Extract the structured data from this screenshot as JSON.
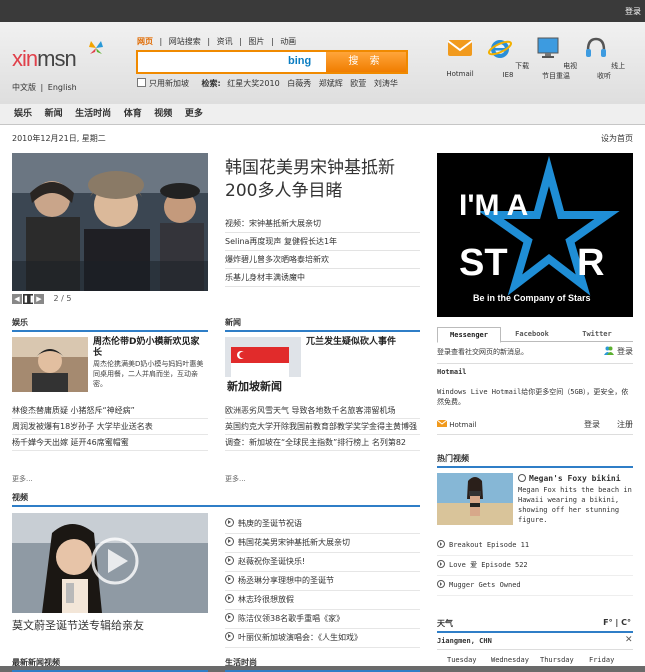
{
  "topbar": {
    "login": "登录"
  },
  "header": {
    "logo_prefix": "xin",
    "logo_suffix": "msn",
    "lang": [
      "中文版",
      "|",
      "English"
    ],
    "search_tabs": [
      "网页",
      "|",
      "网站搜索",
      "|",
      "资讯",
      "|",
      "图片",
      "|",
      "动画"
    ],
    "search_value": "",
    "bing_label": "bing",
    "search_button": "搜 索",
    "option_checkbox": "只用新加坡",
    "hot_label": "检索:",
    "hot_terms": [
      "红星大奖2010",
      "白薇秀",
      "郑斌辉",
      "欧萱",
      "刘涛华"
    ],
    "apps": [
      {
        "label": "Hotmail",
        "icon": "envelope-icon"
      },
      {
        "label": "下载IE8",
        "icon": "ie-icon"
      },
      {
        "label": "电视节目重温",
        "icon": "monitor-icon"
      },
      {
        "label": "线上收听",
        "icon": "headphones-icon"
      }
    ]
  },
  "nav": [
    "娱乐",
    "新闻",
    "生活时尚",
    "体育",
    "视频",
    "更多"
  ],
  "content": {
    "date": "2010年12月21日, 星期二",
    "set_home": "设为首页",
    "pager": {
      "prev": "◀",
      "pause": "❚❚",
      "next": "▶",
      "text": "2 / 5"
    },
    "headline": "韩国花美男宋钟基抵新200多人争目睹",
    "headline_links": [
      "视频：宋钟基抵新大展亲切",
      "Selina再度现声 复健假长达1年",
      "爆炸碧儿曾多次晒咯泰培新欢",
      "乐基儿身材丰满诱魔中"
    ],
    "ad": {
      "line1": "I'M A",
      "line2": "ST",
      "line3": "R",
      "tagline": "Be in the Company of Stars"
    },
    "ent": {
      "title": "娱乐",
      "feature_title": "周杰伦带D奶小模新欢见家长",
      "feature_desc": "周杰伦携满美D奶小模与妈妈叶惠美同桌用餐，二人并肩而坐，互动亲密。",
      "links": [
        "林俊杰替庸质疑 小猪怒斥“神经病”",
        "周润发被爆有18岁孙子 大学毕业送名表",
        "杨千嬅今天出嫁 延开46席蜜帽蜜"
      ],
      "more": "更多..."
    },
    "news": {
      "title": "新闻",
      "feature_title": "兀兰发生疑似砍人事件",
      "thumb_text": "新加坡新闻",
      "links": [
        "欧洲恶劣风雪天气 导致各地数千名旅客滞留机场",
        "英国约克大学开除我国前教育部教学奖学金得主黄博强",
        "调查：新加坡在“全球民主指数”排行榜上 名列第82"
      ],
      "more": "更多..."
    },
    "video": {
      "title": "视频",
      "caption": "莫文蔚圣诞节送专辑给亲友",
      "links": [
        "韩庚的圣诞节祝语",
        "韩国花美男宋钟基抵新大展亲切",
        "赵薇祝你圣诞快乐!",
        "杨丞琳分享理想中的圣诞节",
        "林志玲很想放假",
        "陈洁仪领38名歌手重唱《家》",
        "叶丽仪新加坡演唱会：《人生如戏》"
      ]
    },
    "bottom_heads": [
      "最新新闻视频",
      "生活时尚"
    ],
    "messenger": {
      "tabs": [
        "Messenger",
        "Facebook",
        "Twitter"
      ],
      "desc": "登录查看社交网页的新消息。",
      "login": "登录",
      "hotmail_head": "Hotmail",
      "hotmail_desc": "Windows Live Hotmail给你更多空间（5GB），更安全，依然免费。",
      "hotmail_link": "Hotmail",
      "hotmail_login": "登录",
      "hotmail_register": "注册"
    },
    "hot_video": {
      "title": "热门视频",
      "feature_title": "Megan's Foxy bikini",
      "feature_desc": "Megan Fox hits the beach in Hawaii wearing a bikini, showing off her stunning figure.",
      "links": [
        "Breakout Episode 11",
        "Love 爱 Episode 522",
        "Mugger Gets Owned"
      ]
    },
    "weather": {
      "title": "天气",
      "units": "F° | C°",
      "city": "Jiangmen, CHN",
      "days": [
        "Tuesday",
        "Wednesday",
        "Thursday",
        "Friday"
      ]
    }
  }
}
